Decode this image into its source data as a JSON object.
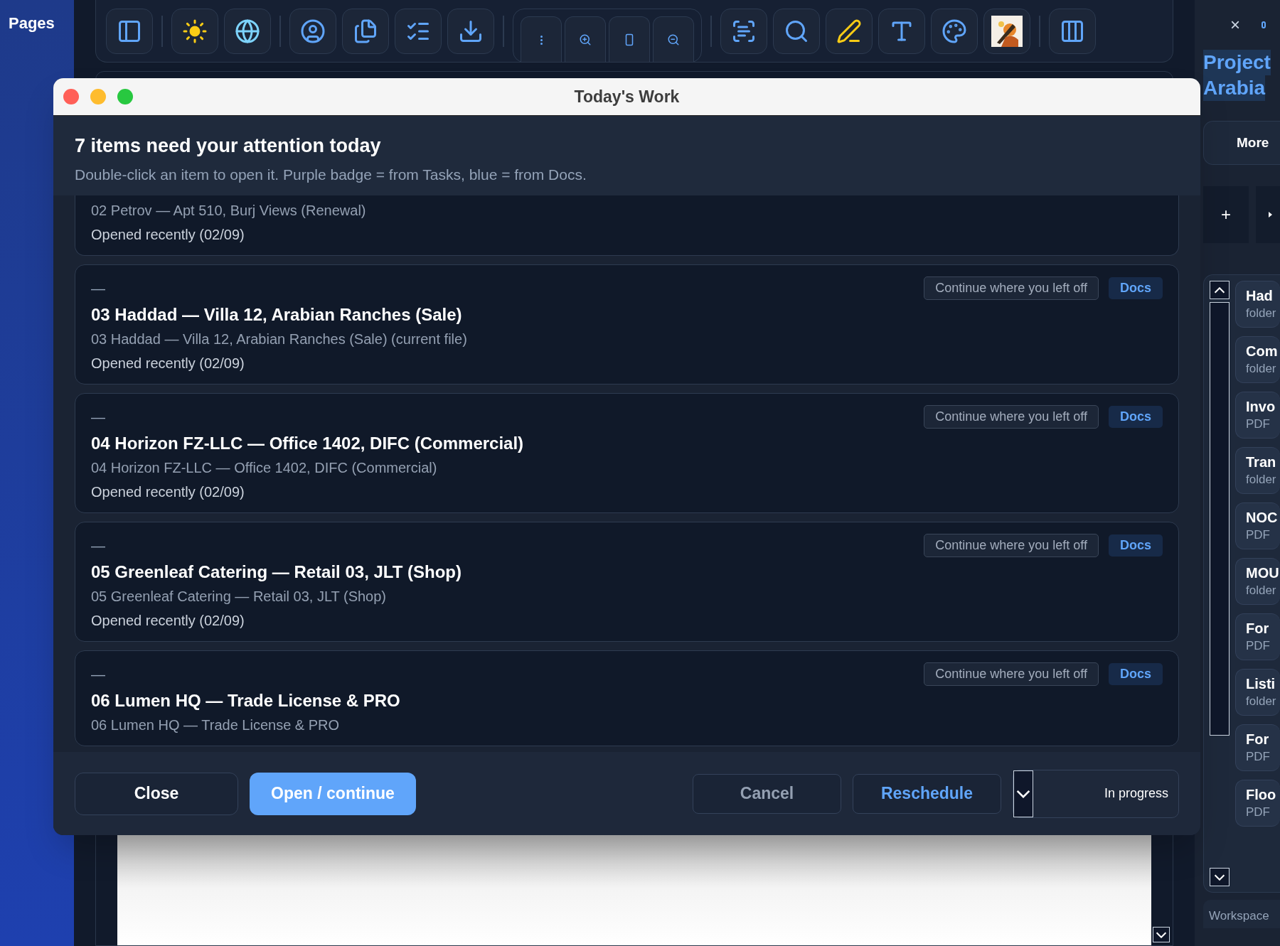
{
  "sidebar": {
    "title": "Pages"
  },
  "dialog": {
    "title": "Today's Work",
    "heading": "7 items need your attention today",
    "subtitle": "Double-click an item to open it. Purple badge = from Tasks, blue = from Docs.",
    "items": [
      {
        "subtitle": "02 Petrov — Apt 510, Burj Views (Renewal)",
        "meta": "Opened recently (02/09)"
      },
      {
        "marker": "—",
        "status": "Continue where you left off",
        "badge": {
          "label": "Docs",
          "kind": "docs"
        },
        "title": "03 Haddad — Villa 12, Arabian Ranches (Sale)",
        "subtitle": "03 Haddad — Villa 12, Arabian Ranches (Sale) (current file)",
        "meta": "Opened recently (02/09)"
      },
      {
        "marker": "—",
        "status": "Continue where you left off",
        "badge": {
          "label": "Docs",
          "kind": "docs"
        },
        "title": "04 Horizon FZ-LLC — Office 1402, DIFC (Commercial)",
        "subtitle": "04 Horizon FZ-LLC — Office 1402, DIFC (Commercial)",
        "meta": "Opened recently (02/09)"
      },
      {
        "marker": "—",
        "status": "Continue where you left off",
        "badge": {
          "label": "Docs",
          "kind": "docs"
        },
        "title": "05 Greenleaf Catering — Retail 03, JLT (Shop)",
        "subtitle": "05 Greenleaf Catering — Retail 03, JLT (Shop)",
        "meta": "Opened recently (02/09)"
      },
      {
        "marker": "—",
        "status": "Continue where you left off",
        "badge": {
          "label": "Docs",
          "kind": "docs"
        },
        "title": "06 Lumen HQ — Trade License & PRO",
        "subtitle": "06 Lumen HQ — Trade License & PRO"
      }
    ],
    "footer": {
      "close": "Close",
      "open": "Open / continue",
      "cancel": "Cancel",
      "reschedule": "Reschedule",
      "status": "In progress"
    }
  },
  "right_panel": {
    "close": "×",
    "title": [
      "Project",
      "Arabia"
    ],
    "more": "More",
    "add": "+",
    "workspace": "Workspace",
    "files": [
      {
        "name": "Had",
        "type": "folder"
      },
      {
        "name": "Com",
        "type": "folder"
      },
      {
        "name": "Invo",
        "type": "PDF"
      },
      {
        "name": "Tran",
        "type": "folder"
      },
      {
        "name": "NOC",
        "type": "PDF"
      },
      {
        "name": "MOU",
        "type": "folder"
      },
      {
        "name": "For",
        "type": "PDF"
      },
      {
        "name": "Listi",
        "type": "folder"
      },
      {
        "name": "For",
        "type": "PDF"
      },
      {
        "name": "Floo",
        "type": "PDF"
      }
    ]
  }
}
